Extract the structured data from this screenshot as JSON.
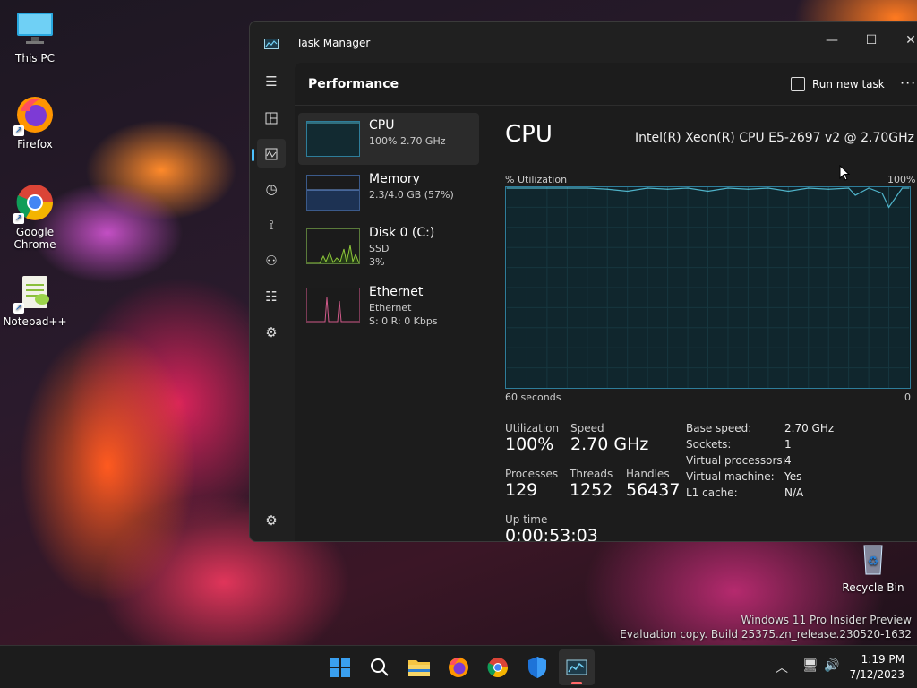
{
  "desktop": {
    "icons": [
      {
        "label": "This PC"
      },
      {
        "label": "Firefox"
      },
      {
        "label": "Google Chrome"
      },
      {
        "label": "Notepad++"
      },
      {
        "label": "Recycle Bin"
      }
    ],
    "watermark": {
      "line1": "Windows 11 Pro Insider Preview",
      "line2": "Evaluation copy. Build 25375.zn_release.230520-1632"
    }
  },
  "window": {
    "title": "Task Manager",
    "controls": {
      "minimize": "—",
      "maximize": "☐",
      "close": "✕"
    }
  },
  "header": {
    "page_title": "Performance",
    "run_new_task": "Run new task",
    "more": "···"
  },
  "nav": {
    "icons": [
      "menu-icon",
      "processes-icon",
      "performance-icon",
      "app-history-icon",
      "startup-apps-icon",
      "users-icon",
      "details-icon",
      "services-icon",
      "settings-icon"
    ],
    "active": "performance-icon"
  },
  "perf_list": [
    {
      "name": "CPU",
      "sub1": "100%  2.70 GHz",
      "sub2": ""
    },
    {
      "name": "Memory",
      "sub1": "2.3/4.0 GB (57%)",
      "sub2": ""
    },
    {
      "name": "Disk 0 (C:)",
      "sub1": "SSD",
      "sub2": "3%"
    },
    {
      "name": "Ethernet",
      "sub1": "Ethernet",
      "sub2": "S: 0  R: 0 Kbps"
    }
  ],
  "detail": {
    "title": "CPU",
    "model": "Intel(R) Xeon(R) CPU E5-2697 v2 @ 2.70GHz",
    "util_label": "% Utilization",
    "util_max": "100%",
    "axis_left": "60 seconds",
    "axis_right": "0",
    "stats": {
      "utilization_label": "Utilization",
      "utilization": "100%",
      "speed_label": "Speed",
      "speed": "2.70 GHz",
      "processes_label": "Processes",
      "processes": "129",
      "threads_label": "Threads",
      "threads": "1252",
      "handles_label": "Handles",
      "handles": "56437",
      "uptime_label": "Up time",
      "uptime": "0:00:53:03"
    },
    "info": [
      {
        "label": "Base speed:",
        "value": "2.70 GHz"
      },
      {
        "label": "Sockets:",
        "value": "1"
      },
      {
        "label": "Virtual processors:",
        "value": "4"
      },
      {
        "label": "Virtual machine:",
        "value": "Yes"
      },
      {
        "label": "L1 cache:",
        "value": "N/A"
      }
    ]
  },
  "chart_data": {
    "type": "area",
    "x": [
      0,
      3,
      6,
      9,
      12,
      15,
      18,
      21,
      24,
      27,
      30,
      33,
      36,
      39,
      42,
      45,
      48,
      51,
      52,
      54,
      56,
      57,
      59,
      60
    ],
    "values": [
      100,
      100,
      100,
      100,
      100,
      99,
      98,
      100,
      99,
      100,
      98,
      100,
      99,
      100,
      98,
      100,
      99,
      100,
      96,
      100,
      97,
      90,
      100,
      100
    ],
    "ylim": [
      0,
      100
    ],
    "ylabel": "% Utilization",
    "colors": {
      "line": "#4fb3c9",
      "fill": "#102a31",
      "grid": "#1f4a55"
    }
  },
  "taskbar": {
    "items": [
      "start-icon",
      "search-icon",
      "file-explorer-icon",
      "firefox-icon",
      "chrome-icon",
      "defender-icon",
      "task-manager-icon"
    ],
    "clock_time": "1:19 PM",
    "clock_date": "7/12/2023"
  }
}
